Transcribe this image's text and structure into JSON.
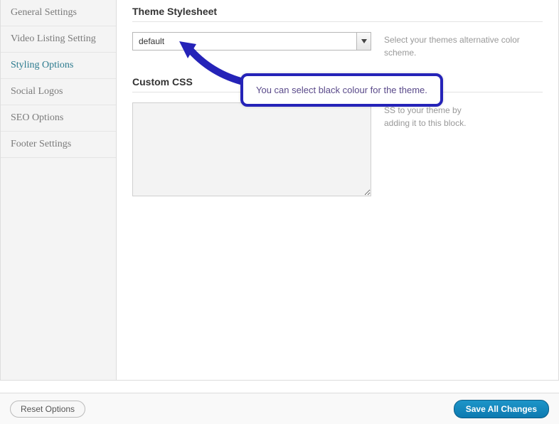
{
  "sidebar": {
    "items": [
      {
        "label": "General Settings"
      },
      {
        "label": "Video Listing Setting"
      },
      {
        "label": "Styling Options"
      },
      {
        "label": "Social Logos"
      },
      {
        "label": "SEO Options"
      },
      {
        "label": "Footer Settings"
      }
    ]
  },
  "sections": {
    "theme_stylesheet": {
      "title": "Theme Stylesheet",
      "selected": "default",
      "help": "Select your themes alternative color scheme."
    },
    "custom_css": {
      "title": "Custom CSS",
      "value": "",
      "help_line1": "SS to your theme by",
      "help_line2": "adding it to this block."
    }
  },
  "callout": {
    "text": "You can select black colour for the theme."
  },
  "footer": {
    "reset": "Reset Options",
    "save": "Save All Changes"
  }
}
